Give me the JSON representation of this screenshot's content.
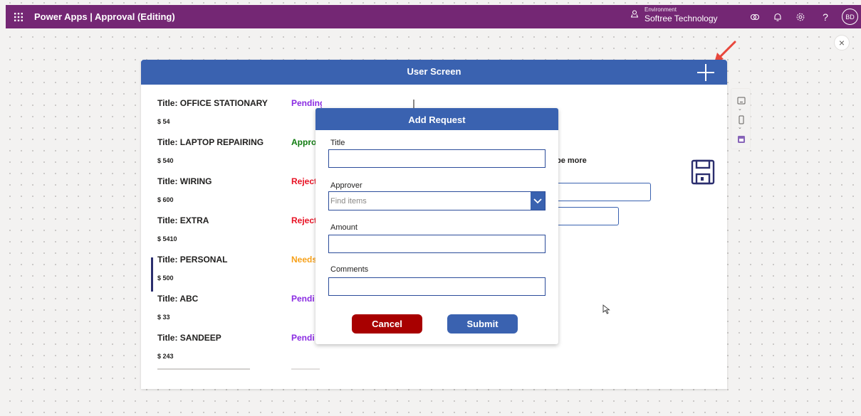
{
  "topbar": {
    "title": "Power Apps  |  Approval (Editing)",
    "environment_label": "Environment",
    "environment_name": "Softree Technology",
    "avatar_initials": "BD",
    "help_label": "?"
  },
  "screen": {
    "title": "User Screen",
    "description_fragment": "be more"
  },
  "gallery": {
    "items": [
      {
        "title": "Title: OFFICE STATIONARY",
        "amount": "$ 54",
        "status": "Pending",
        "status_color": "#8a2be2"
      },
      {
        "title": "Title: LAPTOP REPAIRING",
        "amount": "$ 540",
        "status": "Appro",
        "status_color": "#107c10"
      },
      {
        "title": "Title: WIRING",
        "amount": "$ 600",
        "status": "Reject",
        "status_color": "#e81123"
      },
      {
        "title": "Title: EXTRA",
        "amount": "$ 5410",
        "status": "Reject",
        "status_color": "#e81123"
      },
      {
        "title": "Title: PERSONAL",
        "amount": "$ 500",
        "status": "Needs",
        "status_color": "#f7a11a"
      },
      {
        "title": "Title: ABC",
        "amount": "$ 33",
        "status": "Pendi",
        "status_color": "#8a2be2"
      },
      {
        "title": "Title: SANDEEP",
        "amount": "$ 243",
        "status": "Pendi",
        "status_color": "#8a2be2"
      }
    ],
    "selected_index": 4
  },
  "dialog": {
    "title": "Add Request",
    "title_label": "Title",
    "title_value": "",
    "approver_label": "Approver",
    "approver_placeholder": "Find items",
    "amount_label": "Amount",
    "amount_value": "",
    "comments_label": "Comments",
    "comments_value": "",
    "cancel_label": "Cancel",
    "submit_label": "Submit"
  },
  "colors": {
    "topbar": "#742774",
    "header_blue": "#3a62b0",
    "cancel_red": "#a80000",
    "arrow": "#e8473c"
  },
  "icons": [
    "waffle-icon",
    "environment-icon",
    "copilot-icon",
    "bell-icon",
    "gear-icon",
    "help-icon",
    "close-icon",
    "plus-icon",
    "save-icon",
    "chevron-down-icon",
    "tablet-icon",
    "phone-icon",
    "calendar-icon",
    "pointer-icon"
  ]
}
